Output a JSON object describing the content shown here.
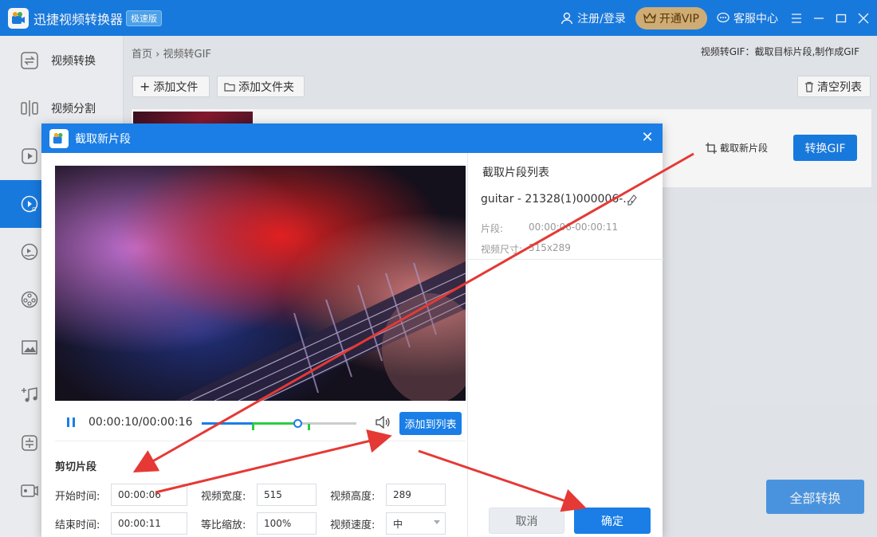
{
  "app": {
    "title": "迅捷视频转换器",
    "badge": "极速版"
  },
  "header": {
    "login": "注册/登录",
    "vip": "开通VIP",
    "service": "客服中心"
  },
  "sidebar": {
    "items": [
      {
        "label": "视频转换",
        "icon": "convert-icon"
      },
      {
        "label": "视频分割",
        "icon": "split-icon"
      },
      {
        "label": "",
        "icon": "video-play-icon"
      },
      {
        "label": "",
        "icon": "gif-icon"
      },
      {
        "label": "",
        "icon": "video-watermark-icon"
      },
      {
        "label": "",
        "icon": "film-reel-icon"
      },
      {
        "label": "",
        "icon": "image-icon"
      },
      {
        "label": "",
        "icon": "music-add-icon"
      },
      {
        "label": "",
        "icon": "compress-icon"
      },
      {
        "label": "",
        "icon": "screen-record-icon"
      }
    ]
  },
  "main": {
    "breadcrumb_home": "首页",
    "breadcrumb_current": "视频转GIF",
    "hint": "视频转GIF：截取目标片段,制作成GIF",
    "add_file": "添加文件",
    "add_folder": "添加文件夹",
    "clear_list": "清空列表",
    "cut_new": "截取新片段",
    "convert_gif": "转换GIF",
    "convert_all": "全部转换"
  },
  "dialog": {
    "title": "截取新片段",
    "timecode": "00:00:10/00:00:16",
    "add_to_list": "添加到列表",
    "section_title": "剪切片段",
    "start_label": "开始时间:",
    "start_value": "00:00:06",
    "end_label": "结束时间:",
    "end_value": "00:00:11",
    "width_label": "视频宽度:",
    "width_value": "515",
    "height_label": "视频高度:",
    "height_value": "289",
    "scale_label": "等比缩放:",
    "scale_value": "100%",
    "speed_label": "视频速度:",
    "speed_value": "中",
    "progress_played": 0.62,
    "clip_start_fraction": 0.33,
    "clip_end_fraction": 0.69
  },
  "clip_list": {
    "title": "截取片段列表",
    "name": "guitar - 21328(1)000006-...",
    "segment_label": "片段:",
    "segment_value": "00:00:06-00:00:11",
    "size_label": "视频尺寸:",
    "size_value": "515x289",
    "cancel": "取消",
    "confirm": "确定"
  },
  "colors": {
    "accent": "#1a7ee6",
    "arrow": "#e53935",
    "vip": "#d9b47a"
  }
}
